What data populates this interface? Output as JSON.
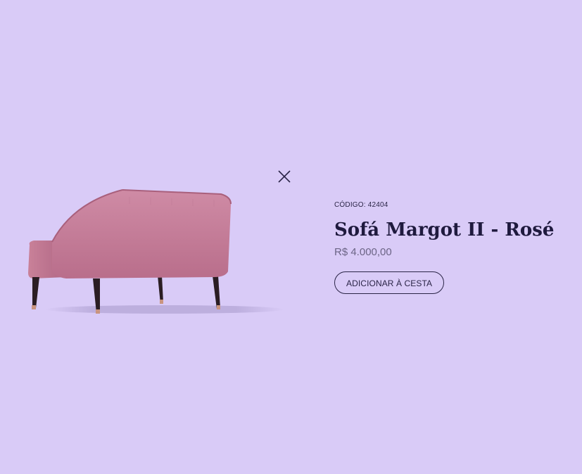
{
  "modal": {
    "close_icon": "close-icon",
    "product": {
      "code_text": "CÓDIGO: 42404",
      "title": "Sofá Margot II - Rosé",
      "price": "R$ 4.000,00",
      "add_to_cart_label": "ADICIONAR À CESTA",
      "image_name": "sofa-image"
    }
  },
  "colors": {
    "background": "#d9cbf7",
    "text_primary": "#1f1a3e",
    "text_muted": "#6c6586",
    "sofa_pink": "#c57c98",
    "leg_dark": "#2b1d23"
  }
}
